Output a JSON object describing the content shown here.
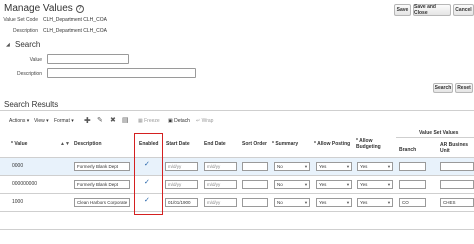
{
  "page": {
    "title": "Manage Values",
    "help_glyph": "?",
    "buttons": {
      "save": "Save",
      "save_and_close": "Save and Close",
      "cancel": "Cancel"
    }
  },
  "header": {
    "value_set_code_label": "Value Set Code",
    "value_set_code": "CLH_Department CLH_COA",
    "description_label": "Description",
    "description": "CLH_Department CLH_COA"
  },
  "search": {
    "section_title": "Search",
    "value_label": "Value",
    "description_label": "Description",
    "search_button": "Search",
    "reset_button": "Reset"
  },
  "results": {
    "section_title": "Search Results",
    "toolbar": {
      "actions": "Actions",
      "view": "View",
      "format": "Format",
      "freeze": "Freeze",
      "detach": "Detach",
      "wrap": "Wrap"
    },
    "columns": {
      "value": "* Value",
      "description": "Description",
      "enabled": "Enabled",
      "start_date": "Start Date",
      "end_date": "End Date",
      "sort_order": "Sort Order",
      "summary": "* Summary",
      "allow_posting": "* Allow Posting",
      "allow_budgeting_1": "* Allow",
      "allow_budgeting_2": "Budgeting",
      "group": "Value Set Values",
      "branch": "Branch",
      "ar_business_unit_1": "AR Busines",
      "ar_business_unit_2": "Unit"
    },
    "date_placeholder": "m/d/yy",
    "rows": [
      {
        "value": "0000",
        "description": "Formerly Blank Dept",
        "enabled": "✓",
        "start_date": "",
        "end_date": "",
        "sort_order": "",
        "summary": "No",
        "allow_posting": "Yes",
        "allow_budgeting": "Yes",
        "branch": "",
        "ar_business_unit": ""
      },
      {
        "value": "000000000",
        "description": "Formerly Blank Dept",
        "enabled": "✓",
        "start_date": "",
        "end_date": "",
        "sort_order": "",
        "summary": "No",
        "allow_posting": "Yes",
        "allow_budgeting": "Yes",
        "branch": "",
        "ar_business_unit": ""
      },
      {
        "value": "1000",
        "description": "Clean Harbors Corporate",
        "enabled": "✓",
        "start_date": "01/01/1900",
        "end_date": "",
        "sort_order": "",
        "summary": "No",
        "allow_posting": "Yes",
        "allow_budgeting": "Yes",
        "branch": "CO",
        "ar_business_unit": "CHES"
      }
    ]
  },
  "colors": {
    "highlight_box": "#d42020",
    "selected_row": "#e8f2fb",
    "check": "#1f5fa8"
  }
}
